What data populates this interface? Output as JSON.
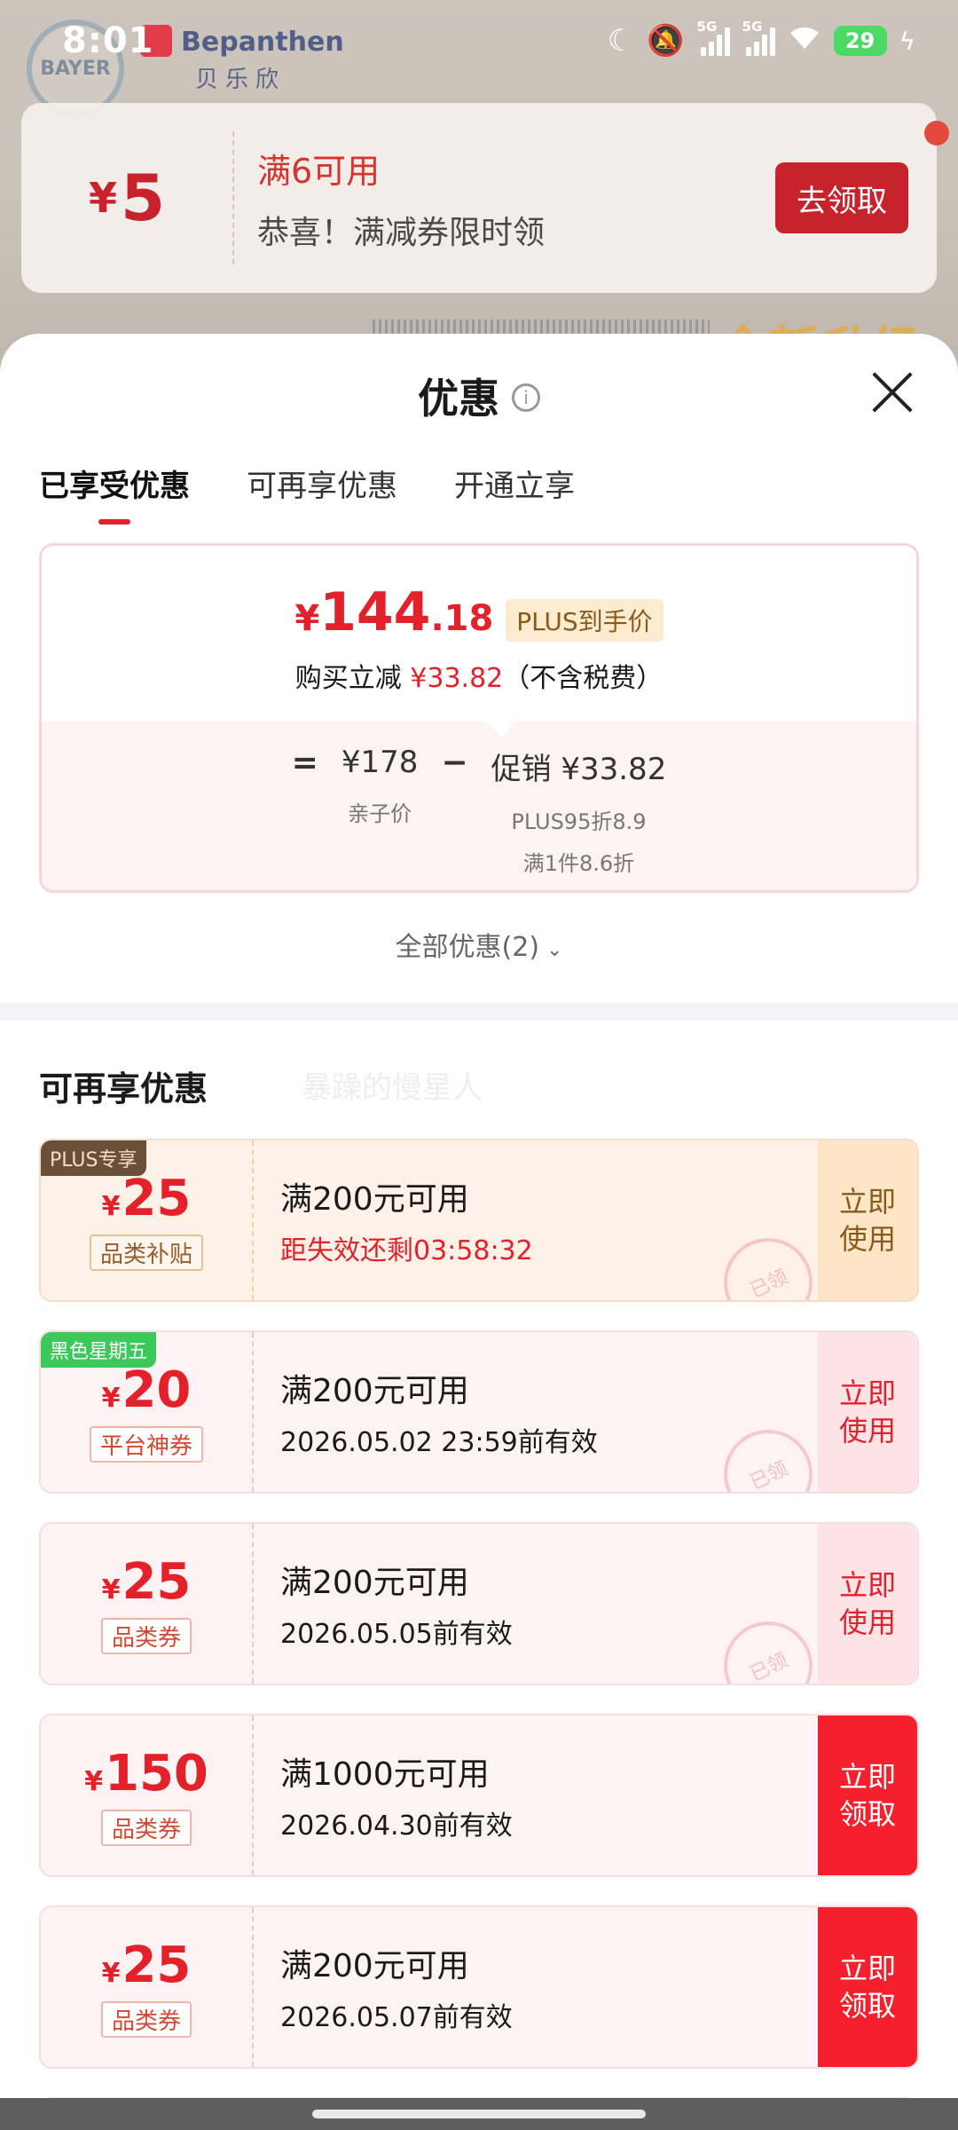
{
  "status_bar": {
    "time": "8:01",
    "signal_1_tag": "5G",
    "signal_2_tag": "5G",
    "battery": "29",
    "icons": [
      "moon-icon",
      "mute-icon",
      "signal-icon",
      "signal-icon",
      "wifi-icon",
      "battery-icon",
      "charging-icon"
    ]
  },
  "background": {
    "brand_logo": "BAYER",
    "brand_name_en": "Bepanthen",
    "brand_name_cn": "贝乐欣",
    "coupon_banner": {
      "currency": "¥",
      "amount": "5",
      "title": "满6可用",
      "subtitle": "恭喜！满减券限时领",
      "button": "去领取"
    },
    "upgrade_text": "全新升级"
  },
  "sheet": {
    "title": "优惠",
    "tabs": [
      {
        "label": "已享受优惠",
        "active": true
      },
      {
        "label": "可再享优惠",
        "active": false
      },
      {
        "label": "开通立享",
        "active": false
      }
    ],
    "price_card": {
      "currency": "¥",
      "price_int": "144",
      "price_dec": ".18",
      "plus_tag": "PLUS到手价",
      "reduce_prefix": "购买立减",
      "reduce_amount": "¥33.82",
      "reduce_suffix": "（不含税费）",
      "equals": "=",
      "base_price": "¥178",
      "base_label": "亲子价",
      "minus": "−",
      "promo": "促销 ¥33.82",
      "promo_line1": "PLUS95折8.9",
      "promo_line2": "满1件8.6折"
    },
    "all_deals": "全部优惠(2)",
    "section_title": "可再享优惠",
    "ghost_watermark": "暴躁的慢星人",
    "coupons": [
      {
        "badge": "PLUS专享",
        "currency": "¥",
        "amount": "25",
        "type": "品类补贴",
        "condition": "满200元可用",
        "expiry": "距失效还剩03:58:32",
        "action_line1": "立即",
        "action_line2": "使用",
        "stamp": "已领"
      },
      {
        "badge": "黑色星期五",
        "currency": "¥",
        "amount": "20",
        "type": "平台神券",
        "condition": "满200元可用",
        "expiry": "2026.05.02 23:59前有效",
        "action_line1": "立即",
        "action_line2": "使用",
        "stamp": "已领"
      },
      {
        "badge": "",
        "currency": "¥",
        "amount": "25",
        "type": "品类券",
        "condition": "满200元可用",
        "expiry": "2026.05.05前有效",
        "action_line1": "立即",
        "action_line2": "使用",
        "stamp": "已领"
      },
      {
        "badge": "",
        "currency": "¥",
        "amount": "150",
        "type": "品类券",
        "condition": "满1000元可用",
        "expiry": "2026.04.30前有效",
        "action_line1": "立即",
        "action_line2": "领取",
        "stamp": ""
      },
      {
        "badge": "",
        "currency": "¥",
        "amount": "25",
        "type": "品类券",
        "condition": "满200元可用",
        "expiry": "2026.05.07前有效",
        "action_line1": "立即",
        "action_line2": "领取",
        "stamp": ""
      }
    ]
  },
  "colors": {
    "accent_red": "#e3212b",
    "plus_gold": "#fdebcf",
    "badge_plus": "#6a4f3b",
    "badge_black_friday": "#3cc95a"
  }
}
